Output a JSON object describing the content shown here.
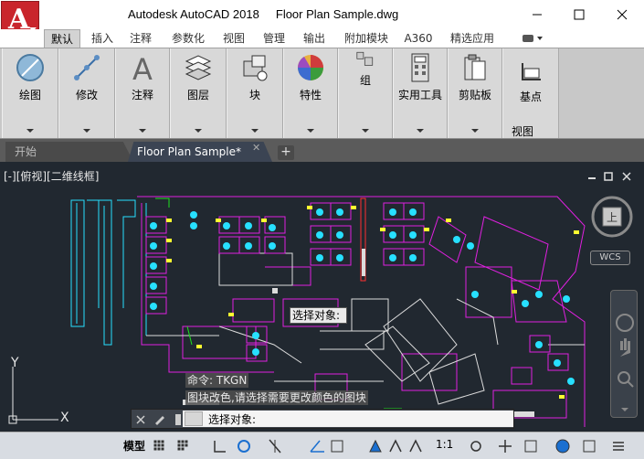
{
  "window": {
    "title": "Autodesk AutoCAD 2018     Floor Plan Sample.dwg",
    "app_letter": "A"
  },
  "ribbon_tabs": [
    "默认",
    "插入",
    "注释",
    "参数化",
    "视图",
    "管理",
    "输出",
    "附加模块",
    "A360",
    "精选应用"
  ],
  "ribbon_groups": [
    {
      "label": "绘图",
      "icon": "draw-icon"
    },
    {
      "label": "修改",
      "icon": "modify-icon"
    },
    {
      "label": "注释",
      "icon": "annotation-icon"
    },
    {
      "label": "图层",
      "icon": "layers-icon"
    },
    {
      "label": "块",
      "icon": "block-icon"
    },
    {
      "label": "特性",
      "icon": "properties-icon"
    },
    {
      "label": "组",
      "icon": "group-icon"
    },
    {
      "label": "实用工具",
      "icon": "calculator-icon"
    },
    {
      "label": "剪贴板",
      "icon": "clipboard-icon"
    },
    {
      "label": "基点",
      "icon": "basepoint-icon"
    }
  ],
  "view_sublabel": "视图",
  "doc_tabs": {
    "start": "开始",
    "file": "Floor Plan Sample*"
  },
  "viewport_label": "[-][俯视][二维线框]",
  "viewcube": {
    "face": "上",
    "wcs": "WCS"
  },
  "tooltip_select": "选择对象:",
  "command": {
    "history_1": "命令: TKGN",
    "history_2": "图块改色,请选择需要更改颜色的图块",
    "prompt": "选择对象:"
  },
  "ucs": {
    "y": "Y",
    "x": "X"
  },
  "status": {
    "model": "模型",
    "scale": "1:1"
  },
  "colors": {
    "background": "#212830",
    "app_red": "#c9252c",
    "magenta": "#e020e0",
    "cyan": "#27e0ff",
    "yellow": "#ffff30",
    "green": "#20e020",
    "white_lines": "#dcdcdc"
  }
}
